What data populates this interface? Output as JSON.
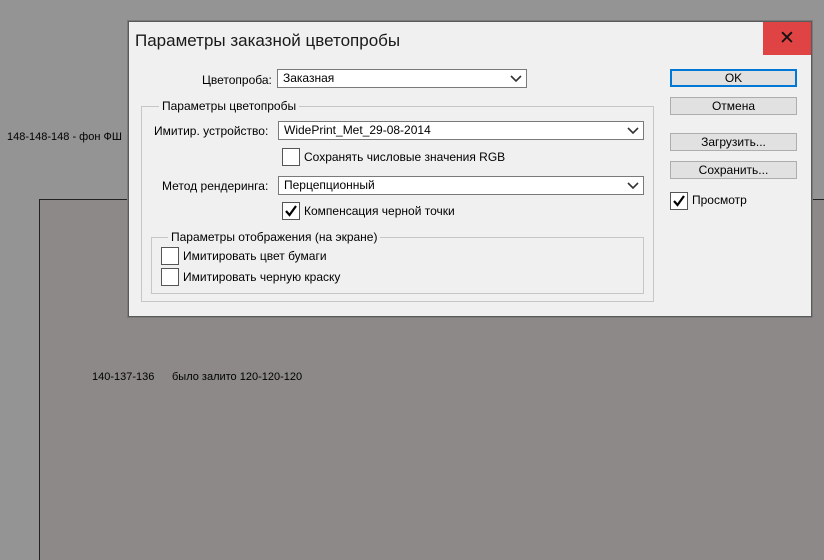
{
  "background": {
    "note_top": "148-148-148 - фон ФШ",
    "note_bottom_left": "140-137-136",
    "note_bottom_right": "было залито 120-120-120"
  },
  "dialog": {
    "title": "Параметры заказной цветопробы",
    "close_glyph": "✕",
    "proof_label": "Цветопроба:",
    "proof_value": "Заказная",
    "group_proof_legend": "Параметры цветопробы",
    "device_label": "Имитир. устройство:",
    "device_value": "WidePrint_Met_29-08-2014",
    "preserve_rgb_label": "Сохранять числовые значения RGB",
    "preserve_rgb_checked": false,
    "rendering_label": "Метод рендеринга:",
    "rendering_value": "Перцепционный",
    "black_point_label": "Компенсация черной точки",
    "black_point_checked": true,
    "group_display_legend": "Параметры отображения (на экране)",
    "sim_paper_label": "Имитировать цвет бумаги",
    "sim_paper_checked": false,
    "sim_ink_label": "Имитировать черную краску",
    "sim_ink_checked": false
  },
  "buttons": {
    "ok": "OK",
    "cancel": "Отмена",
    "load": "Загрузить...",
    "save": "Сохранить...",
    "preview_label": "Просмотр",
    "preview_checked": true
  },
  "colors": {
    "bg": "#949494",
    "inner_panel": "#8c8988",
    "dialog_bg": "#f0f0f0",
    "close_red": "#e04343",
    "focus_blue": "#0078d7"
  }
}
